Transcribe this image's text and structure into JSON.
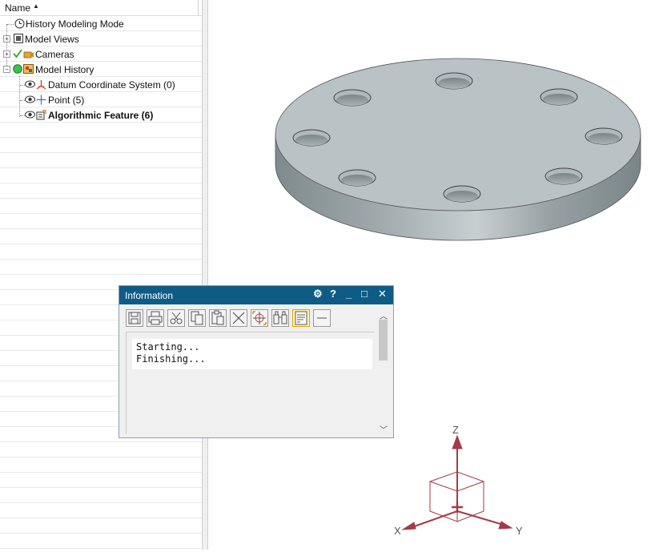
{
  "navigator": {
    "column_header": "Name",
    "sort_icon": "sort-ascending-icon",
    "rows": [
      {
        "label": "History Modeling Mode",
        "icon": "clock-icon"
      },
      {
        "label": "Model Views",
        "icon": "model-views-icon"
      },
      {
        "label": "Cameras",
        "icon": "camera-icon"
      },
      {
        "label": "Model History",
        "icon": "model-history-icon"
      },
      {
        "label": "Datum Coordinate System (0)",
        "icon": "datum-csys-icon"
      },
      {
        "label": "Point (5)",
        "icon": "point-icon"
      },
      {
        "label": "Algorithmic Feature (6)",
        "icon": "algorithmic-feature-icon"
      }
    ]
  },
  "info_window": {
    "title": "Information",
    "title_buttons": {
      "settings": "⚙",
      "help": "?",
      "minimize": "_",
      "maximize": "□",
      "close": "✕"
    },
    "toolbar": [
      "save-icon",
      "print-icon",
      "cut-icon",
      "copy-icon",
      "paste-icon",
      "delete-icon",
      "snap-point-icon",
      "find-icon",
      "word-wrap-icon",
      "collapse-icon"
    ],
    "output_lines": [
      "Starting...",
      "Finishing..."
    ]
  },
  "triad": {
    "x": "X",
    "y": "Y",
    "z": "Z"
  },
  "colors": {
    "title_bar": "#0e5c86",
    "part_face": "#b8c1c4",
    "triad": "#a33a4a"
  }
}
